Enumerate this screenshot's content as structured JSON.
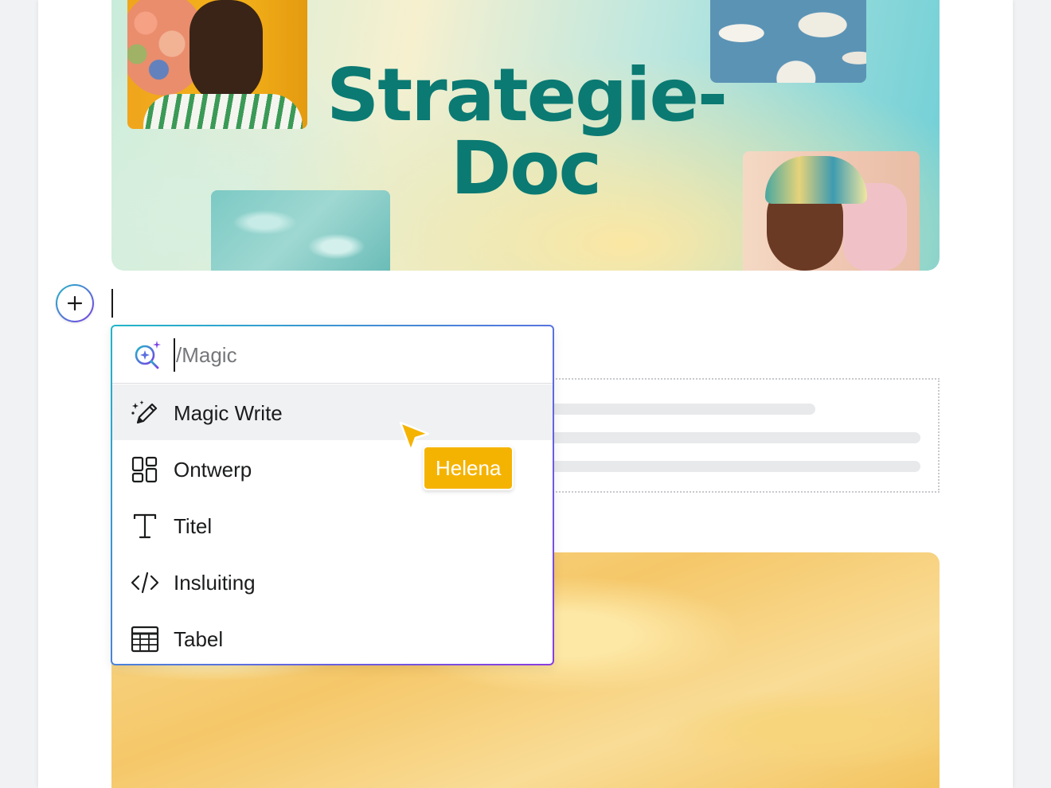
{
  "hero": {
    "title_line1": "Strategie-",
    "title_line2": "Doc",
    "title_color": "#0b7a73"
  },
  "add_block": {
    "icon": "plus-icon"
  },
  "menu": {
    "search": {
      "value": "",
      "placeholder": "/Magic",
      "icon": "magic-search-icon"
    },
    "items": [
      {
        "label": "Magic Write",
        "icon": "magic-pencil-icon",
        "active": true
      },
      {
        "label": "Ontwerp",
        "icon": "layout-grid-icon",
        "active": false
      },
      {
        "label": "Titel",
        "icon": "text-t-icon",
        "active": false
      },
      {
        "label": "Insluiting",
        "icon": "code-embed-icon",
        "active": false
      },
      {
        "label": "Tabel",
        "icon": "table-icon",
        "active": false
      }
    ],
    "border_gradient": [
      "#20b6c8",
      "#8b3ce0"
    ]
  },
  "collaborator": {
    "name": "Helena",
    "color": "#f5b301"
  }
}
